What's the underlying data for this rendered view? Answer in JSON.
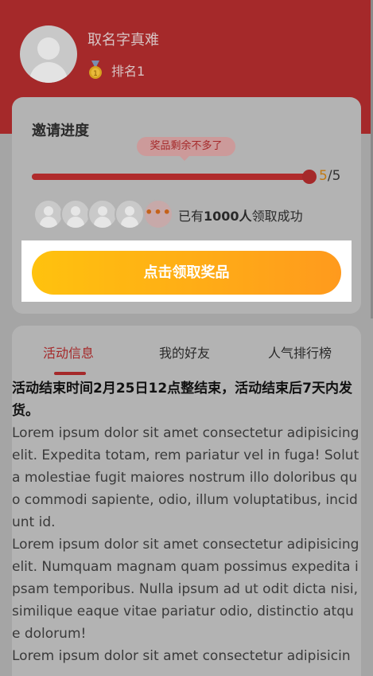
{
  "user": {
    "name": "取名字真难",
    "rank": "排名1",
    "medal_icon": "gold-medal-icon"
  },
  "invite": {
    "title": "邀请进度",
    "bubble": "奖品剩余不多了",
    "progress": {
      "current": "5",
      "separator": "/",
      "total": "5",
      "fraction": 1.0
    },
    "more_icon": "•••",
    "success_prefix": "已有",
    "success_count": "1000人",
    "success_suffix": "领取成功",
    "claim_label": "点击领取奖品"
  },
  "tabs": [
    {
      "label": "活动信息",
      "active": true
    },
    {
      "label": "我的好友",
      "active": false
    },
    {
      "label": "人气排行榜",
      "active": false
    }
  ],
  "content": {
    "notice": "活动结束时间2月25日12点整结束，活动结束后7天内发货。",
    "paragraphs": [
      "Lorem ipsum dolor sit amet consectetur adipisicing elit. Expedita totam, rem pariatur vel in fuga! Soluta molestiae fugit maiores nostrum illo doloribus quo commodi sapiente, odio, illum voluptatibus, incidunt id.",
      "Lorem ipsum dolor sit amet consectetur adipisicing elit. Numquam magnam quam possimus expedita ipsam temporibus. Nulla ipsum ad ut odit dicta nisi, similique eaque vitae pariatur odio, distinctio atque dolorum!",
      "Lorem ipsum dolor sit amet consectetur adipisicin"
    ]
  },
  "colors": {
    "brand_red": "#a5292a",
    "progress_accent": "#c27a12",
    "button_gradient_start": "#ffc20e",
    "button_gradient_end": "#ff9a1d"
  }
}
